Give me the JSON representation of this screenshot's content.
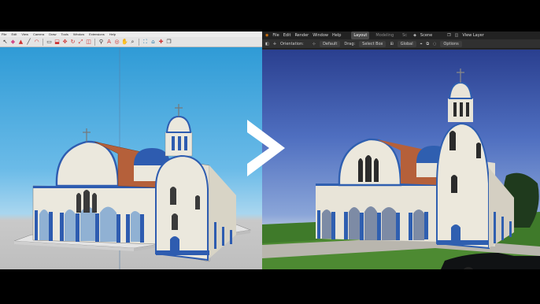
{
  "sketchup": {
    "menu": [
      "File",
      "Edit",
      "View",
      "Camera",
      "Draw",
      "Tools",
      "Window",
      "Extensions",
      "Help"
    ],
    "toolbar_icons": [
      "select-icon",
      "eraser-icon",
      "paint-icon",
      "line-icon",
      "arc-icon",
      "rectangle-icon",
      "pushpull-icon",
      "move-icon",
      "rotate-icon",
      "scale-icon",
      "offset-icon",
      "tape-icon",
      "text-icon",
      "orbit-icon",
      "pan-icon",
      "zoom-icon",
      "zoom-extents-icon",
      "warehouse-icon",
      "extension-icon",
      "layers-icon"
    ]
  },
  "blender": {
    "menu": [
      "File",
      "Edit",
      "Render",
      "Window",
      "Help"
    ],
    "workspaces": [
      {
        "label": "Layout",
        "active": true
      },
      {
        "label": "Modeling",
        "active": false
      },
      {
        "label": "Sc",
        "active": false
      }
    ],
    "scene_label": "Scene",
    "view_layer_label": "View Layer",
    "tool_header": {
      "orientation_label": "Orientation:",
      "orientation_value": "Default",
      "drag_label": "Drag:",
      "drag_value": "Select Box",
      "transform_value": "Global",
      "options_label": "Options"
    }
  },
  "colors": {
    "accent_blue": "#2f5fb0",
    "wall_white": "#e8e4d8",
    "roof_terracotta": "#b5603a"
  }
}
